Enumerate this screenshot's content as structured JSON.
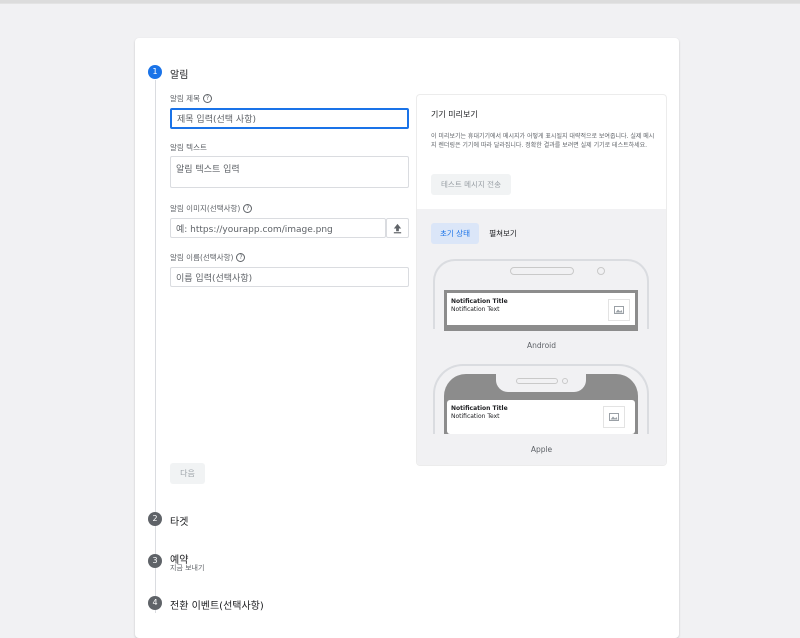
{
  "steps": [
    {
      "number": "1",
      "title": "알림",
      "sub": ""
    },
    {
      "number": "2",
      "title": "타겟",
      "sub": ""
    },
    {
      "number": "3",
      "title": "예약",
      "sub": "지금 보내기"
    },
    {
      "number": "4",
      "title": "전환 이벤트(선택사항)",
      "sub": ""
    }
  ],
  "form": {
    "title_label": "알림 제목",
    "title_placeholder": "제목 입력(선택 사항)",
    "text_label": "알림 텍스트",
    "text_placeholder": "알림 텍스트 입력",
    "image_label": "알림 이미지(선택사항)",
    "image_placeholder": "예: https://yourapp.com/image.png",
    "name_label": "알림 이름(선택사항)",
    "name_placeholder": "이름 입력(선택사항)",
    "next_button": "다음"
  },
  "preview": {
    "title": "기기 미리보기",
    "description": "이 미리보기는 휴대기기에서 메시지가 어떻게 표시될지 대략적으로 보여줍니다. 실제 메시지 렌더링은 기기에 따라 달라집니다. 정확한 결과를 보려면 실제 기기로 테스트하세요.",
    "test_button": "테스트 메시지 전송",
    "tabs": [
      {
        "label": "초기 상태"
      },
      {
        "label": "펼쳐보기"
      }
    ],
    "android": {
      "label": "Android",
      "notif_title": "Notification Title",
      "notif_text": "Notification Text"
    },
    "apple": {
      "label": "Apple",
      "notif_title": "Notification Title",
      "notif_text": "Notification Text"
    }
  },
  "colors": {
    "accent": "#1a73e8",
    "step_inactive": "#5f6368",
    "border": "#dadce0"
  }
}
